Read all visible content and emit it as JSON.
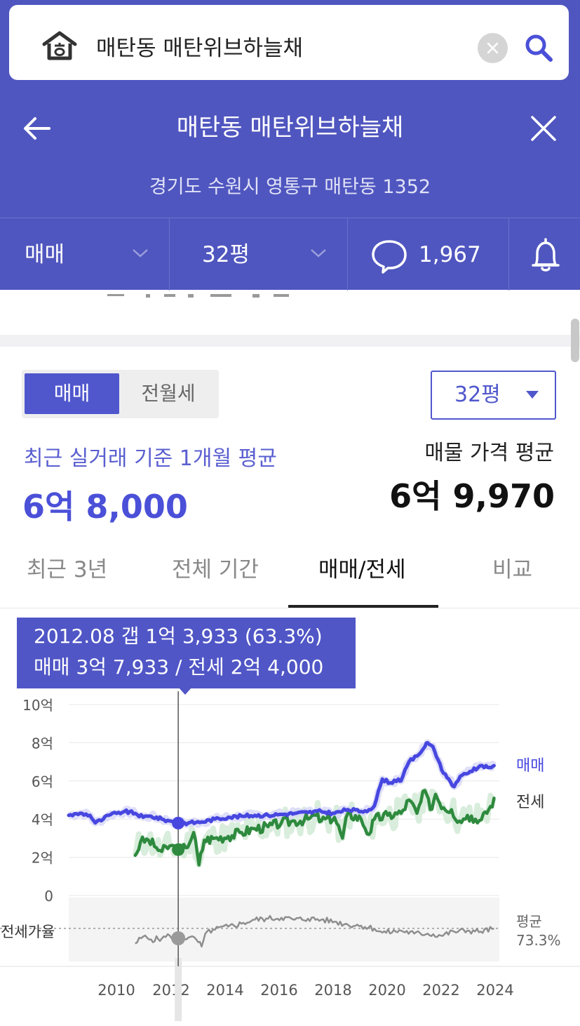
{
  "search": {
    "value": "매탄동 매탄위브하늘채"
  },
  "header": {
    "title": "매탄동 매탄위브하늘채",
    "address": "경기도 수원시 영통구 매탄동 1352"
  },
  "filters": {
    "trade_type": "매매",
    "size": "32평",
    "comment_count": "1,967"
  },
  "segment": {
    "options": [
      "매매",
      "전월세"
    ],
    "selected": "매매"
  },
  "size_dropdown": {
    "value": "32평"
  },
  "summary": {
    "recent_label": "최근 실거래 기준 1개월 평균",
    "recent_price": "6억 8,000",
    "listing_label": "매물 가격 평균",
    "listing_price": "6억 9,970"
  },
  "tabs": [
    {
      "label": "최근 3년",
      "active": false
    },
    {
      "label": "전체 기간",
      "active": false
    },
    {
      "label": "매매/전세",
      "active": true
    },
    {
      "label": "비교",
      "active": false
    }
  ],
  "tooltip": {
    "line1": "2012.08  갭 1억 3,933 (63.3%)",
    "line2": "매매 3억 7,933 / 전세 2억 4,000"
  },
  "colors": {
    "header_bg": "#5056bf",
    "accent": "#4b50d8",
    "sale_line": "#4747e0",
    "jeonse_line": "#2e8a3e",
    "ratio_line": "#8e8e8e"
  },
  "chart_data": {
    "type": "line",
    "y_unit": "억",
    "y_ticks": [
      "10억",
      "8억",
      "6억",
      "4억",
      "2억",
      "0"
    ],
    "ylim": [
      0,
      10
    ],
    "x_ticks": [
      "2010",
      "2012",
      "2014",
      "2016",
      "2018",
      "2020",
      "2022",
      "2024"
    ],
    "xlim": [
      2008.5,
      2024.7
    ],
    "grid": true,
    "ratio_label": "전세가율",
    "average_label": "평균",
    "average_value": "73.3%",
    "selected_point": {
      "x": 2012.62,
      "sale": 3.79,
      "jeonse": 2.4,
      "ratio": 63.3
    },
    "series": [
      {
        "name": "매매",
        "points": [
          [
            2008.5,
            4.2
          ],
          [
            2009.0,
            4.3
          ],
          [
            2009.3,
            4.2
          ],
          [
            2009.5,
            3.8
          ],
          [
            2009.8,
            4.0
          ],
          [
            2010.0,
            4.2
          ],
          [
            2010.3,
            4.3
          ],
          [
            2010.6,
            4.4
          ],
          [
            2011.0,
            4.3
          ],
          [
            2011.3,
            4.1
          ],
          [
            2011.6,
            4.15
          ],
          [
            2012.0,
            4.0
          ],
          [
            2012.3,
            3.9
          ],
          [
            2012.62,
            3.79
          ],
          [
            2013.0,
            3.8
          ],
          [
            2013.5,
            3.85
          ],
          [
            2014.0,
            4.0
          ],
          [
            2014.5,
            4.1
          ],
          [
            2015.0,
            4.15
          ],
          [
            2015.5,
            4.2
          ],
          [
            2016.0,
            4.2
          ],
          [
            2016.5,
            4.25
          ],
          [
            2017.0,
            4.3
          ],
          [
            2017.5,
            4.35
          ],
          [
            2018.0,
            4.4
          ],
          [
            2018.5,
            4.3
          ],
          [
            2019.0,
            4.5
          ],
          [
            2019.5,
            4.4
          ],
          [
            2019.8,
            4.5
          ],
          [
            2020.0,
            4.7
          ],
          [
            2020.3,
            6.1
          ],
          [
            2020.6,
            5.9
          ],
          [
            2020.9,
            6.1
          ],
          [
            2021.0,
            6.0
          ],
          [
            2021.3,
            7.0
          ],
          [
            2021.6,
            7.3
          ],
          [
            2021.9,
            7.8
          ],
          [
            2022.0,
            8.0
          ],
          [
            2022.2,
            7.8
          ],
          [
            2022.4,
            7.1
          ],
          [
            2022.6,
            6.4
          ],
          [
            2022.8,
            6.1
          ],
          [
            2023.0,
            5.7
          ],
          [
            2023.3,
            6.3
          ],
          [
            2023.6,
            6.5
          ],
          [
            2023.9,
            6.7
          ],
          [
            2024.2,
            6.8
          ],
          [
            2024.4,
            6.7
          ],
          [
            2024.5,
            6.8
          ]
        ]
      },
      {
        "name": "전세",
        "points": [
          [
            2011.0,
            2.1
          ],
          [
            2011.2,
            2.8
          ],
          [
            2011.5,
            2.9
          ],
          [
            2011.8,
            2.5
          ],
          [
            2012.0,
            2.3
          ],
          [
            2012.3,
            2.6
          ],
          [
            2012.62,
            2.4
          ],
          [
            2012.9,
            2.5
          ],
          [
            2013.2,
            3.3
          ],
          [
            2013.4,
            1.6
          ],
          [
            2013.6,
            2.9
          ],
          [
            2014.0,
            3.0
          ],
          [
            2014.5,
            3.1
          ],
          [
            2015.0,
            3.3
          ],
          [
            2015.5,
            3.5
          ],
          [
            2016.0,
            3.6
          ],
          [
            2016.5,
            3.8
          ],
          [
            2017.0,
            3.9
          ],
          [
            2017.5,
            4.0
          ],
          [
            2017.8,
            4.2
          ],
          [
            2018.0,
            3.9
          ],
          [
            2018.5,
            4.1
          ],
          [
            2018.8,
            3.0
          ],
          [
            2019.0,
            4.3
          ],
          [
            2019.5,
            4.0
          ],
          [
            2019.8,
            3.2
          ],
          [
            2020.0,
            4.0
          ],
          [
            2020.5,
            4.2
          ],
          [
            2021.0,
            4.3
          ],
          [
            2021.3,
            5.0
          ],
          [
            2021.6,
            4.3
          ],
          [
            2021.9,
            5.5
          ],
          [
            2022.1,
            4.5
          ],
          [
            2022.3,
            5.3
          ],
          [
            2022.6,
            4.6
          ],
          [
            2022.9,
            4.5
          ],
          [
            2023.2,
            3.9
          ],
          [
            2023.5,
            4.2
          ],
          [
            2023.8,
            4.0
          ],
          [
            2024.1,
            4.3
          ],
          [
            2024.3,
            4.5
          ],
          [
            2024.5,
            5.1
          ]
        ]
      },
      {
        "name": "전세가율",
        "points": [
          [
            2011.0,
            58
          ],
          [
            2011.3,
            65
          ],
          [
            2011.6,
            62
          ],
          [
            2012.0,
            63
          ],
          [
            2012.3,
            66
          ],
          [
            2012.62,
            63.3
          ],
          [
            2013.0,
            64
          ],
          [
            2013.3,
            62
          ],
          [
            2013.5,
            55
          ],
          [
            2013.7,
            70
          ],
          [
            2014.0,
            72
          ],
          [
            2014.5,
            75
          ],
          [
            2015.0,
            78
          ],
          [
            2015.5,
            82
          ],
          [
            2016.0,
            83
          ],
          [
            2016.5,
            84
          ],
          [
            2017.0,
            82
          ],
          [
            2017.5,
            83
          ],
          [
            2018.0,
            82
          ],
          [
            2018.5,
            80
          ],
          [
            2019.0,
            77
          ],
          [
            2019.5,
            76
          ],
          [
            2020.0,
            73
          ],
          [
            2020.3,
            69
          ],
          [
            2020.8,
            70
          ],
          [
            2021.0,
            71
          ],
          [
            2021.5,
            68
          ],
          [
            2022.0,
            68
          ],
          [
            2022.5,
            66
          ],
          [
            2023.0,
            70
          ],
          [
            2023.5,
            71
          ],
          [
            2024.0,
            70
          ],
          [
            2024.5,
            73
          ]
        ]
      }
    ]
  }
}
